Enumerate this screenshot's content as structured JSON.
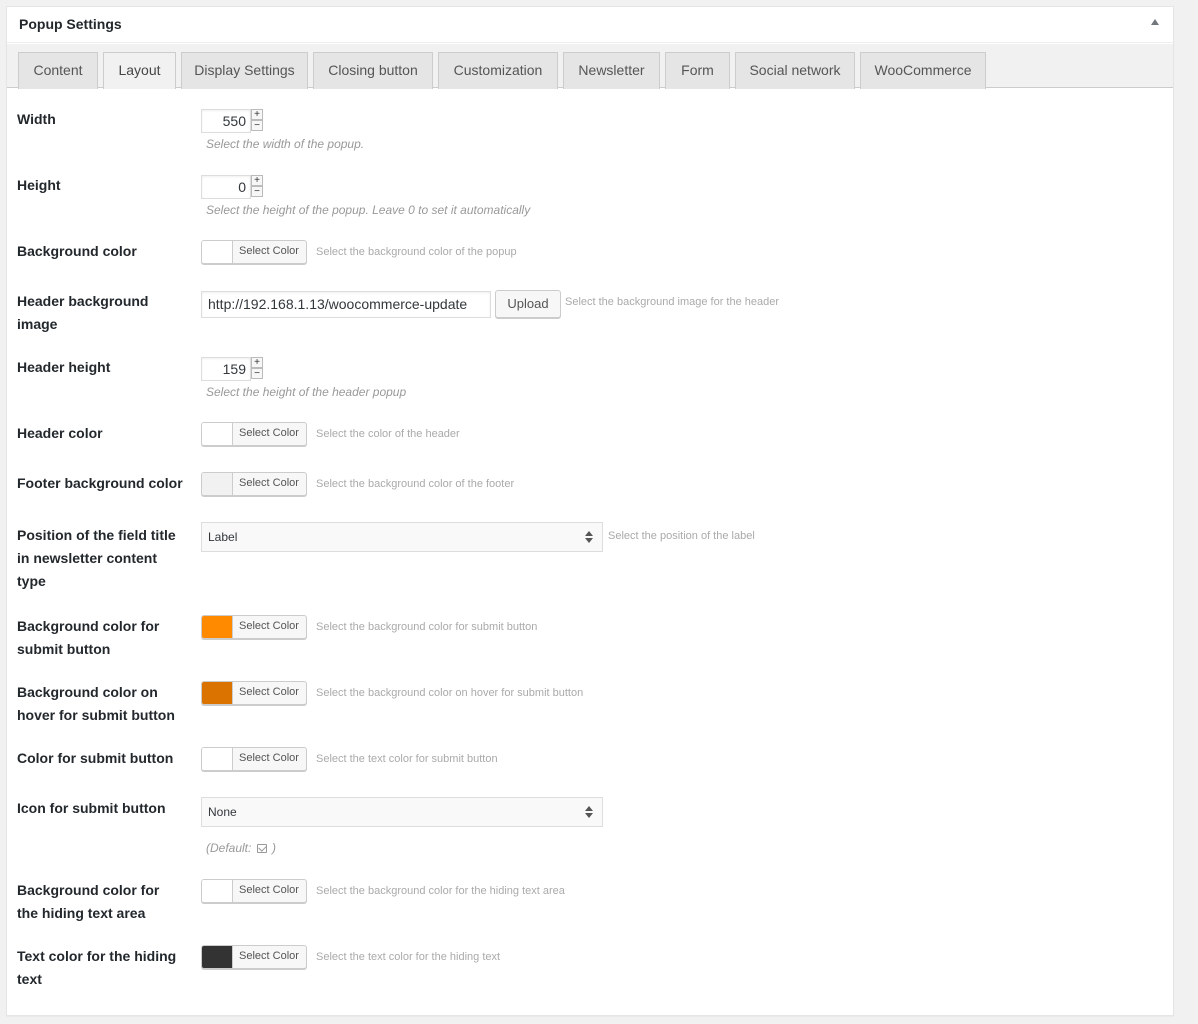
{
  "panel": {
    "title": "Popup Settings"
  },
  "tabs": [
    {
      "label": "Content"
    },
    {
      "label": "Layout",
      "active": true
    },
    {
      "label": "Display Settings"
    },
    {
      "label": "Closing button"
    },
    {
      "label": "Customization"
    },
    {
      "label": "Newsletter"
    },
    {
      "label": "Form"
    },
    {
      "label": "Social network"
    },
    {
      "label": "WooCommerce"
    }
  ],
  "fields": {
    "width": {
      "label": "Width",
      "value": "550",
      "description": "Select the width of the popup."
    },
    "height": {
      "label": "Height",
      "value": "0",
      "description": "Select the height of the popup. Leave 0 to set it automatically"
    },
    "background_color": {
      "label": "Background color",
      "color": "#ffffff",
      "button": "Select Color",
      "description": "Select the background color of the popup"
    },
    "header_bg_image": {
      "label": "Header background image",
      "value": "http://192.168.1.13/woocommerce-update",
      "button": "Upload",
      "description": "Select the background image for the header"
    },
    "header_height": {
      "label": "Header height",
      "value": "159",
      "description": "Select the height of the header popup"
    },
    "header_color": {
      "label": "Header color",
      "color": "#ffffff",
      "button": "Select Color",
      "description": "Select the color of the header"
    },
    "footer_bg_color": {
      "label": "Footer background color",
      "color": "#f1f1f1",
      "button": "Select Color",
      "description": "Select the background color of the footer"
    },
    "field_title_position": {
      "label": "Position of the field title in newsletter content type",
      "selected": "Label",
      "description": "Select the position of the label"
    },
    "submit_bg_color": {
      "label": "Background color for submit button",
      "color": "#ff8a00",
      "button": "Select Color",
      "description": "Select the background color for submit button"
    },
    "submit_hover_bg_color": {
      "label": "Background color on hover for submit button",
      "color": "#db7300",
      "button": "Select Color",
      "description": "Select the background color on hover for submit button"
    },
    "submit_color": {
      "label": "Color for submit button",
      "color": "#ffffff",
      "button": "Select Color",
      "description": "Select the text color for submit button"
    },
    "submit_icon": {
      "label": "Icon for submit button",
      "selected": "None",
      "default_prefix": "(Default:",
      "default_suffix": ")",
      "default_icon": "mail-icon"
    },
    "hiding_bg_color": {
      "label": "Background color for the hiding text area",
      "color": "#ffffff",
      "button": "Select Color",
      "description": "Select the background color for the hiding text area"
    },
    "hiding_text_color": {
      "label": "Text color for the hiding text",
      "color": "#333333",
      "button": "Select Color",
      "description": "Select the text color for the hiding text"
    }
  }
}
